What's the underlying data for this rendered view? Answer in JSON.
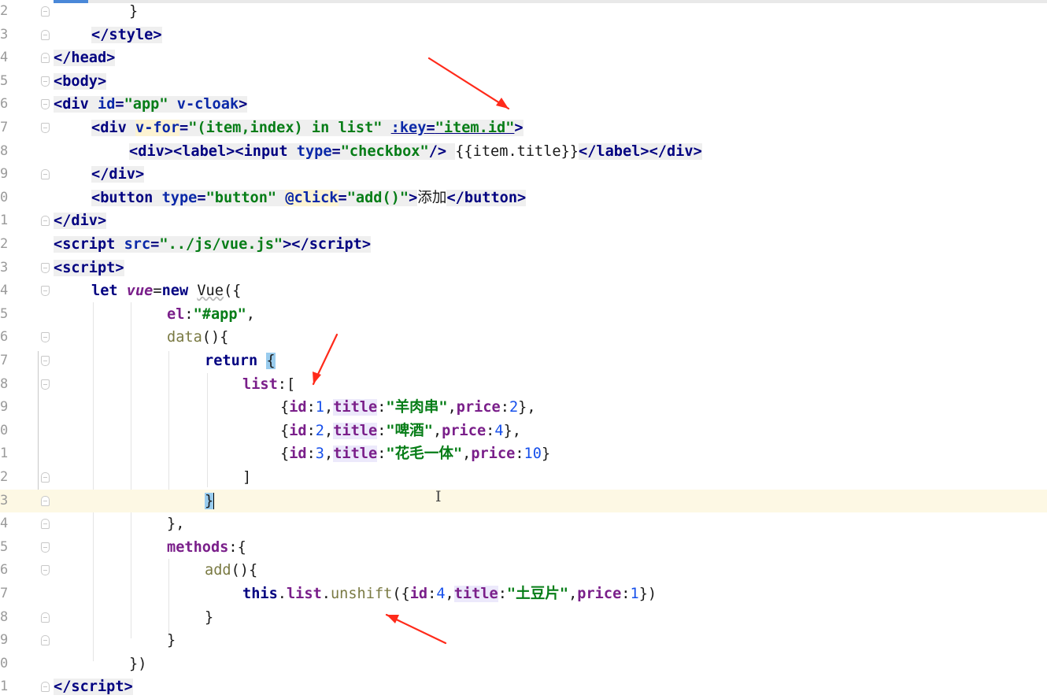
{
  "editor": {
    "line_numbers": [
      "2",
      "3",
      "4",
      "5",
      "6",
      "7",
      "8",
      "9",
      "0",
      "1",
      "2",
      "3",
      "4",
      "5",
      "6",
      "7",
      "8",
      "9",
      "0",
      "1",
      "2",
      "3",
      "4",
      "5",
      "6",
      "7",
      "8",
      "9",
      "0",
      "1"
    ],
    "lines": [
      [
        "}"
      ],
      [
        "</",
        "style",
        ">"
      ],
      [
        "</",
        "head",
        ">"
      ],
      [
        "<",
        "body",
        ">"
      ],
      [
        "<",
        "div",
        " ",
        "id",
        "=",
        "\"app\"",
        " ",
        "v-cloak",
        ">"
      ],
      [
        "<",
        "div",
        " ",
        "v-for",
        "=",
        "\"(item,index) in list\"",
        " ",
        ":key",
        "=",
        "\"item.id\"",
        ">"
      ],
      [
        "<",
        "div",
        "><",
        "label",
        "><",
        "input",
        " ",
        "type",
        "=",
        "\"checkbox\"",
        "/> ",
        "{{item.title}}",
        "</",
        "label",
        "></",
        "div",
        ">"
      ],
      [
        "</",
        "div",
        ">"
      ],
      [
        "<",
        "button",
        " ",
        "type",
        "=",
        "\"button\"",
        " ",
        "@click",
        "=",
        "\"add()\"",
        ">",
        "添加",
        "</",
        "button",
        ">"
      ],
      [
        "</",
        "div",
        ">"
      ],
      [
        "<",
        "script",
        " ",
        "src",
        "=",
        "\"../js/vue.js\"",
        "></",
        "script",
        ">"
      ],
      [
        "<",
        "script",
        ">"
      ],
      [
        "let ",
        "vue",
        "=",
        "new ",
        "Vue",
        "({"
      ],
      [
        "el",
        ":",
        "\"#app\"",
        ","
      ],
      [
        "data",
        "(){"
      ],
      [
        "return ",
        "{"
      ],
      [
        "list",
        ":["
      ],
      [
        "{",
        "id",
        ":",
        "1",
        ",",
        "title",
        ":",
        "\"羊肉串\"",
        ",",
        "price",
        ":",
        "2",
        "},"
      ],
      [
        "{",
        "id",
        ":",
        "2",
        ",",
        "title",
        ":",
        "\"啤酒\"",
        ",",
        "price",
        ":",
        "4",
        "},"
      ],
      [
        "{",
        "id",
        ":",
        "3",
        ",",
        "title",
        ":",
        "\"花毛一体\"",
        ",",
        "price",
        ":",
        "10",
        "}"
      ],
      [
        "]"
      ],
      [
        "}"
      ],
      [
        "},"
      ],
      [
        "methods",
        ":{"
      ],
      [
        "add",
        "(){"
      ],
      [
        "this",
        ".",
        "list",
        ".",
        "unshift",
        "({",
        "id",
        ":",
        "4",
        ",",
        "title",
        ":",
        "\"土豆片\"",
        ",",
        "price",
        ":",
        "1",
        "})"
      ],
      [
        "}"
      ],
      [
        "}"
      ],
      [
        "})"
      ],
      [
        "</",
        "script",
        ">"
      ]
    ]
  },
  "colors": {
    "tag": "#000080",
    "attribute": "#0a28a8",
    "string": "#067d17",
    "property": "#7a1f8a",
    "number": "#1750eb",
    "function": "#7a7a43",
    "current_line": "#fdf8e4",
    "annotation_arrow": "#ff2a1a"
  },
  "icons": {
    "fold_markers": "fold-marker-icon",
    "text_cursor": "i-beam-cursor-icon",
    "annotations": "red-arrow-icon"
  }
}
